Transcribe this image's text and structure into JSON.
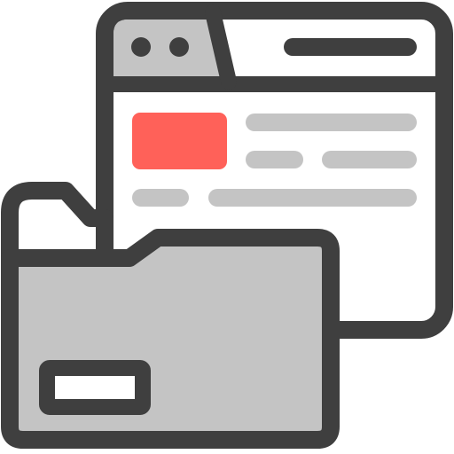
{
  "icon": {
    "name": "browser-window-with-folder-icon",
    "parts": [
      "browser-window-icon",
      "folder-icon"
    ]
  },
  "colors": {
    "outline": "#3f3f3f",
    "window_fill": "#ffffff",
    "titlebar_fill": "#c4c4c4",
    "placeholder_line": "#c4c4c4",
    "accent_block": "#ff6159",
    "folder_fill": "#c4c4c4",
    "folder_label_fill": "#ffffff",
    "dots": "#3f3f3f"
  }
}
